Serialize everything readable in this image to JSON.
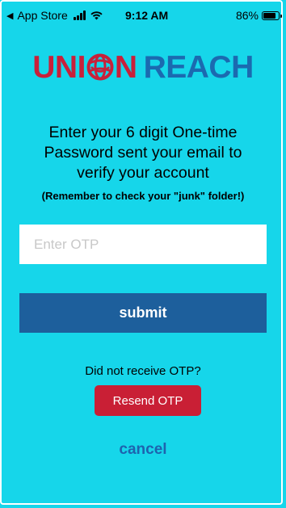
{
  "status_bar": {
    "back_label": "App Store",
    "time": "9:12 AM",
    "battery_percent": "86%",
    "battery_level": 0.86,
    "icons": [
      "back-arrow-icon",
      "cell-signal-icon",
      "wifi-icon",
      "battery-icon"
    ]
  },
  "logo": {
    "part1": "UNI",
    "part2": "N",
    "part3": "REACH",
    "colors": {
      "union": "#c8203a",
      "reach": "#1b6ab0"
    }
  },
  "main": {
    "heading": "Enter your 6 digit One-time Password sent your email to verify your account",
    "reminder": "(Remember to check your \"junk\" folder!)",
    "otp_placeholder": "Enter OTP",
    "otp_value": "",
    "submit_label": "submit",
    "no_otp_text": "Did not receive OTP?",
    "resend_label": "Resend OTP",
    "cancel_label": "cancel"
  },
  "colors": {
    "background": "#16d6ea",
    "submit": "#1d5f9c",
    "resend": "#c91f35",
    "cancel_text": "#1e63ae"
  }
}
